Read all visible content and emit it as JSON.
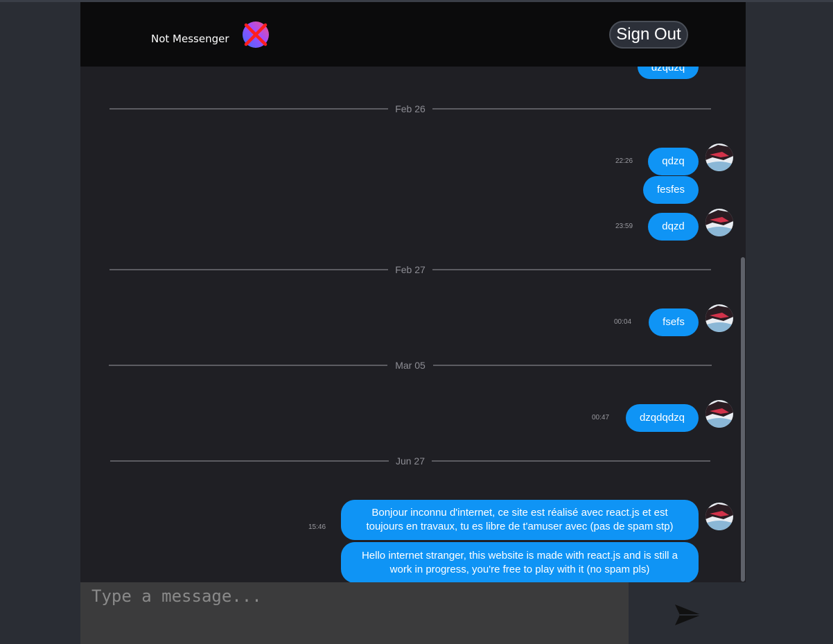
{
  "header": {
    "brand": "Not Messenger",
    "sign_out_label": "Sign Out"
  },
  "messages": {
    "top_partial_text": "dzqdzq",
    "dividers": [
      "Feb 26",
      "Feb 27",
      "Mar 05",
      "Jun 27"
    ],
    "items": [
      {
        "time": "22:26",
        "text": "qdzq"
      },
      {
        "time": "",
        "text": "fesfes"
      },
      {
        "time": "23:59",
        "text": "dqzd"
      },
      {
        "time": "00:04",
        "text": "fsefs"
      },
      {
        "time": "00:47",
        "text": "dzqdqdzq"
      },
      {
        "time": "15:46",
        "text": "Bonjour inconnu d'internet, ce site est réalisé avec react.js et est toujours en travaux, tu es libre de t'amuser avec (pas de spam stp)"
      },
      {
        "time": "",
        "text": "Hello internet stranger, this website is made with react.js and is still a work in progress, you're free to play with it (no spam pls)"
      }
    ]
  },
  "composer": {
    "placeholder": "Type a message..."
  },
  "icons": {
    "logo": "messenger-logo-crossed-icon",
    "avatar": "user-avatar",
    "send": "paper-plane-icon"
  },
  "colors": {
    "bubble": "#0f94f5",
    "header_bg": "#0b0b0c",
    "chat_bg": "#1f1f24",
    "input_bg": "#3b3b3c"
  }
}
